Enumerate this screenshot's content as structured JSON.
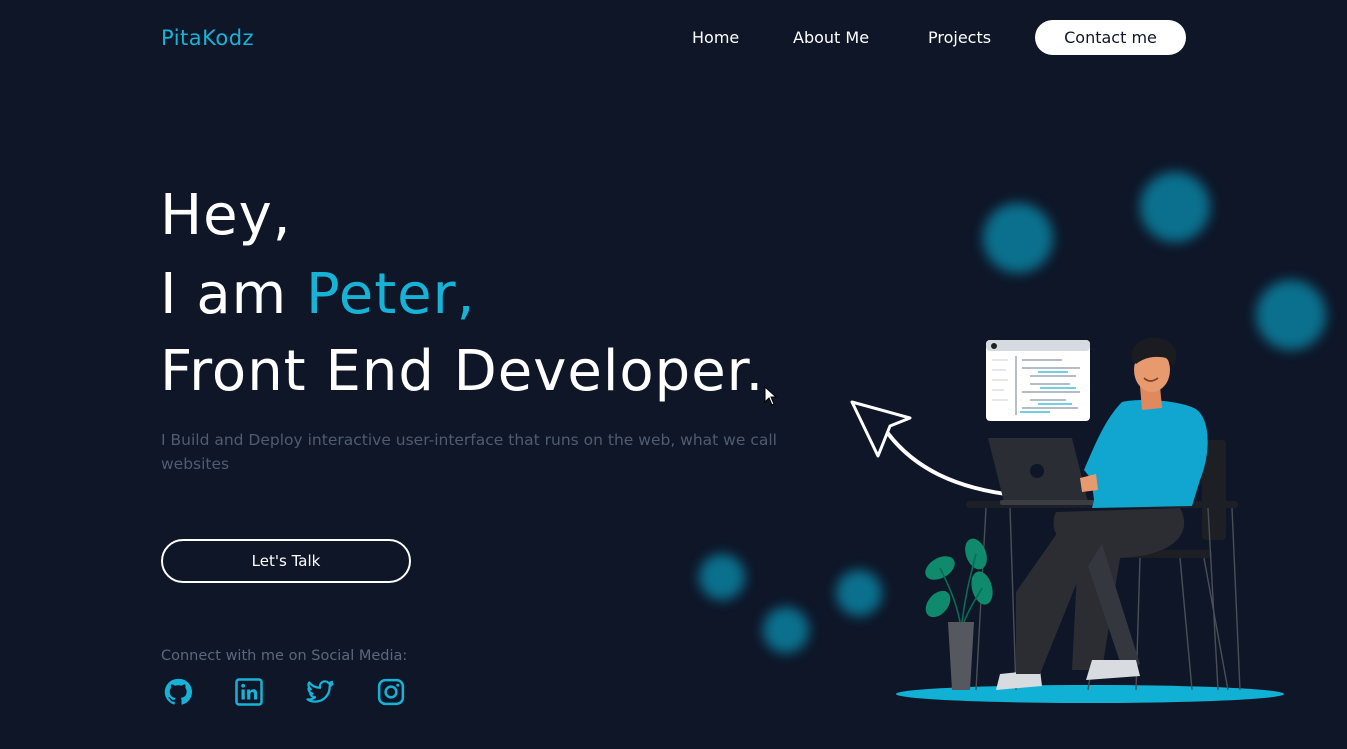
{
  "header": {
    "logo": "PitaKodz",
    "nav": {
      "home": "Home",
      "about": "About Me",
      "projects": "Projects",
      "contact": "Contact me"
    }
  },
  "hero": {
    "greeting": "Hey,",
    "intro_prefix": "I am ",
    "name": "Peter,",
    "role": "Front End Developer.",
    "description": "I Build and Deploy interactive user-interface that runs on the web, what we call websites",
    "cta_label": "Let's Talk"
  },
  "social": {
    "caption": "Connect with me on Social Media:",
    "icons": [
      "github-icon",
      "linkedin-icon",
      "twitter-icon",
      "instagram-icon"
    ]
  },
  "colors": {
    "background": "#0e1628",
    "accent": "#16b3d6",
    "muted_text": "#515c70",
    "button_bg": "#ffffff"
  }
}
